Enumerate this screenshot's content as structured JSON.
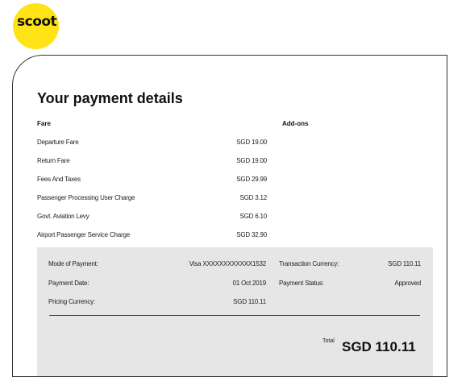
{
  "brand": {
    "logo_text": "scoot",
    "accent_color": "#ffe315"
  },
  "page": {
    "title": "Your payment details"
  },
  "columns": {
    "fare": "Fare",
    "addons": "Add-ons"
  },
  "fare_items": [
    {
      "label": "Departure Fare",
      "value": "SGD 19.00"
    },
    {
      "label": "Return Fare",
      "value": "SGD 19.00"
    },
    {
      "label": "Fees And Taxes",
      "value": "SGD 29.99"
    },
    {
      "label": "Passenger Processing User Charge",
      "value": "SGD 3.12"
    },
    {
      "label": "Govt. Aviation Levy",
      "value": "SGD 6.10"
    },
    {
      "label": "Airport Passenger Service Charge",
      "value": "SGD 32.90"
    }
  ],
  "summary": {
    "mode_label": "Mode of Payment:",
    "mode_value": "Visa XXXXXXXXXXXX1532",
    "date_label": "Payment Date:",
    "date_value": "01 Oct 2019",
    "pricing_label": "Pricing Currency:",
    "pricing_value": "SGD 110.11",
    "txn_label": "Transaction Currency:",
    "txn_value": "SGD 110.11",
    "status_label": "Payment Status:",
    "status_value": "Approved",
    "total_label": "Total",
    "total_amount": "SGD 110.11"
  }
}
